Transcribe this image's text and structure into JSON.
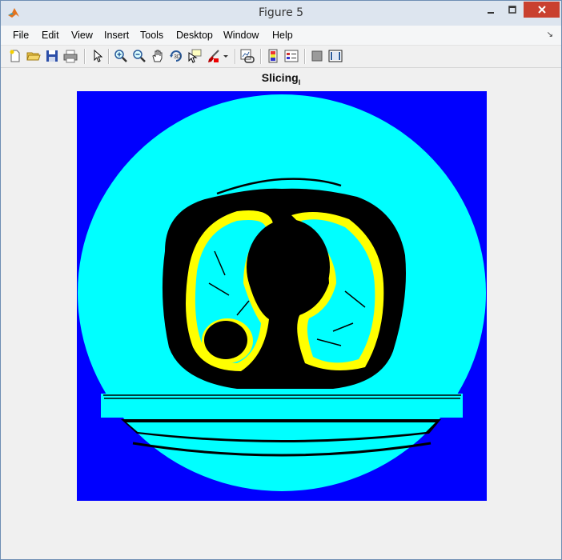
{
  "window": {
    "title": "Figure 5"
  },
  "menu": [
    "File",
    "Edit",
    "View",
    "Insert",
    "Tools",
    "Desktop",
    "Window",
    "Help"
  ],
  "toolbar": {
    "tools": [
      "new-figure",
      "open-file",
      "save",
      "print",
      "select-arrow",
      "zoom-in",
      "zoom-out",
      "pan-hand",
      "rotate-3d",
      "data-cursor",
      "brush",
      "brush-dropdown",
      "link-plot",
      "insert-colorbar",
      "insert-legend",
      "hide-plot-tools",
      "show-plot-tools"
    ]
  },
  "plot": {
    "title_main": "Slicing",
    "title_sub": "I"
  },
  "colors": {
    "background": "#0000ff",
    "body": "#00ffff",
    "tissue_dark": "#000000",
    "lung_highlight": "#ffff00",
    "window_bg": "#f0f0f0"
  }
}
